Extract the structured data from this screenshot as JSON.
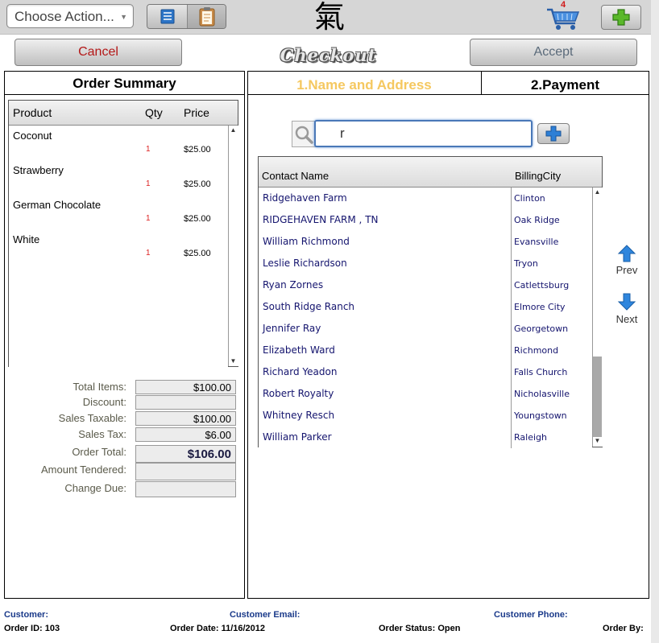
{
  "toolbar": {
    "choose_action": "Choose Action...",
    "cart_count": "4",
    "logo_glyph": "氣",
    "checkout_title": "Checkout",
    "cancel_label": "Cancel",
    "accept_label": "Accept"
  },
  "order_summary": {
    "title": "Order Summary",
    "columns": [
      "Product",
      "Qty",
      "Price"
    ],
    "items": [
      {
        "name": "Coconut",
        "qty": "1",
        "price": "$25.00"
      },
      {
        "name": "Strawberry",
        "qty": "1",
        "price": "$25.00"
      },
      {
        "name": "German Chocolate",
        "qty": "1",
        "price": "$25.00"
      },
      {
        "name": "White",
        "qty": "1",
        "price": "$25.00"
      }
    ],
    "totals": [
      {
        "label": "Total Items:",
        "value": "$100.00"
      },
      {
        "label": "Discount:",
        "value": ""
      },
      {
        "label": "Sales Taxable:",
        "value": "$100.00"
      },
      {
        "label": "Sales Tax:",
        "value": "$6.00"
      },
      {
        "label": "Order Total:",
        "value": "$106.00"
      },
      {
        "label": "Amount Tendered:",
        "value": ""
      },
      {
        "label": "Change Due:",
        "value": ""
      }
    ]
  },
  "steps": {
    "step1": "1.Name and Address",
    "step2": "2.Payment"
  },
  "search": {
    "value": "r"
  },
  "contacts": {
    "columns": [
      "Contact Name",
      "BillingCity"
    ],
    "rows": [
      {
        "name": "Ridgehaven Farm",
        "city": "Clinton"
      },
      {
        "name": "RIDGEHAVEN FARM , TN",
        "city": "Oak Ridge"
      },
      {
        "name": "William Richmond",
        "city": "Evansville"
      },
      {
        "name": "Leslie Richardson",
        "city": "Tryon"
      },
      {
        "name": "Ryan Zornes",
        "city": "Catlettsburg"
      },
      {
        "name": "South Ridge Ranch",
        "city": "Elmore City"
      },
      {
        "name": "Jennifer  Ray",
        "city": "Georgetown"
      },
      {
        "name": "Elizabeth Ward",
        "city": "Richmond"
      },
      {
        "name": "Richard Yeadon",
        "city": "Falls Church"
      },
      {
        "name": "Robert Royalty",
        "city": "Nicholasville"
      },
      {
        "name": "Whitney Resch",
        "city": "Youngstown"
      },
      {
        "name": "William Parker",
        "city": "Raleigh"
      }
    ],
    "prev_label": "Prev",
    "next_label": "Next"
  },
  "footer": {
    "customer": "Customer:",
    "customer_email": "Customer Email:",
    "customer_phone": "Customer Phone:",
    "order_id": "Order ID: 103",
    "order_date": "Order Date: 11/16/2012",
    "order_status": "Order Status: Open",
    "order_by": "Order By:"
  },
  "colors": {
    "cancel_text": "#b41818",
    "step1_text": "#f5c860",
    "contact_text": "#14146e",
    "qty_text": "#dd2222",
    "footer_label": "#1a3a8a"
  }
}
